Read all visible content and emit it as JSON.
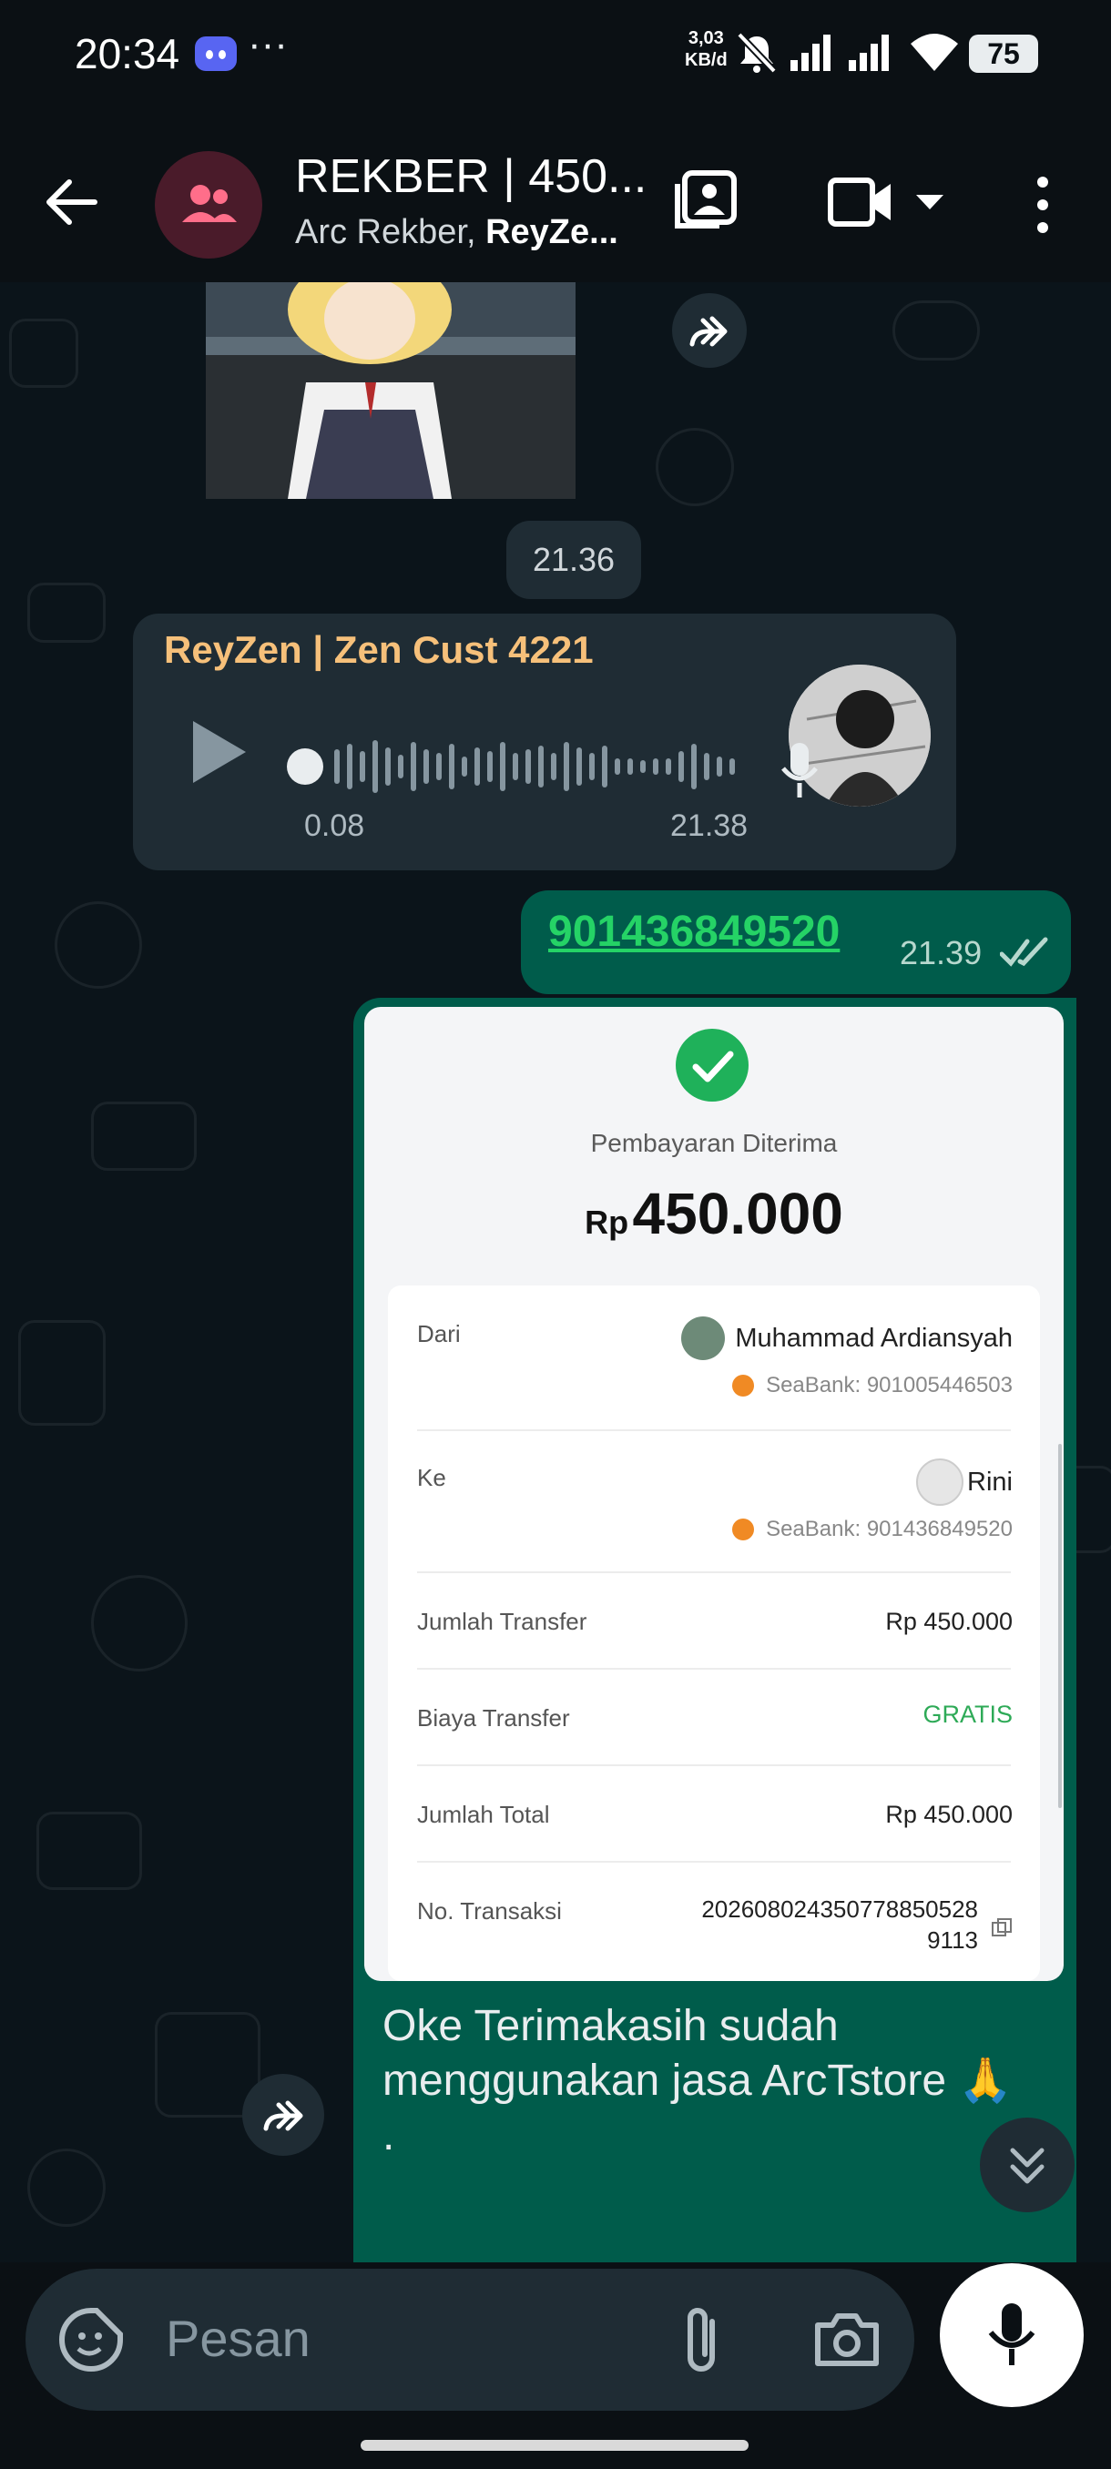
{
  "status_bar": {
    "time": "20:34",
    "overflow": "···",
    "net_speed_value": "3,03",
    "net_speed_unit": "KB/d",
    "battery": "75",
    "icons": [
      "discord-icon",
      "bell-off-icon",
      "signal-icon",
      "signal-icon",
      "wifi-icon",
      "battery-icon"
    ]
  },
  "header": {
    "title": "REKBER | 450...",
    "subtitle_prefix": "Arc Rekber, ",
    "subtitle_bold": "ReyZe...",
    "icons": [
      "back-arrow-icon",
      "group-icon",
      "gallery-icon",
      "video-call-icon",
      "chevron-down-icon",
      "more-vert-icon"
    ]
  },
  "messages": {
    "image_time": "21.36",
    "voice": {
      "sender": "ReyZen | Zen Cust 4221",
      "duration": "0.08",
      "time": "21.38"
    },
    "account_msg": {
      "text": "901436849520",
      "time": "21.39"
    },
    "receipt": {
      "status": "Pembayaran Diterima",
      "currency": "Rp",
      "amount": "450.000",
      "from_label": "Dari",
      "from_name": "Muhammad Ardiansyah",
      "from_bank": "SeaBank: 901005446503",
      "to_label": "Ke",
      "to_name": "Rini",
      "to_bank": "SeaBank: 901436849520",
      "rows": [
        {
          "label": "Jumlah Transfer",
          "value": "Rp 450.000"
        },
        {
          "label": "Biaya Transfer",
          "value": "GRATIS"
        },
        {
          "label": "Jumlah Total",
          "value": "Rp 450.000"
        }
      ],
      "txn_label": "No. Transaksi",
      "txn_line1": "20260802435077885052​8",
      "txn_line2": "9113"
    },
    "thanks_text": "Oke Terimakasih sudah menggunakan jasa ArcTstore 🙏 ."
  },
  "input": {
    "placeholder": "Pesan"
  },
  "colors": {
    "accent_green": "#25d366",
    "out_bubble": "#005c4b",
    "in_bubble": "#1f2c34",
    "sender_name": "#f6c07a",
    "gratis": "#2eaa57"
  }
}
